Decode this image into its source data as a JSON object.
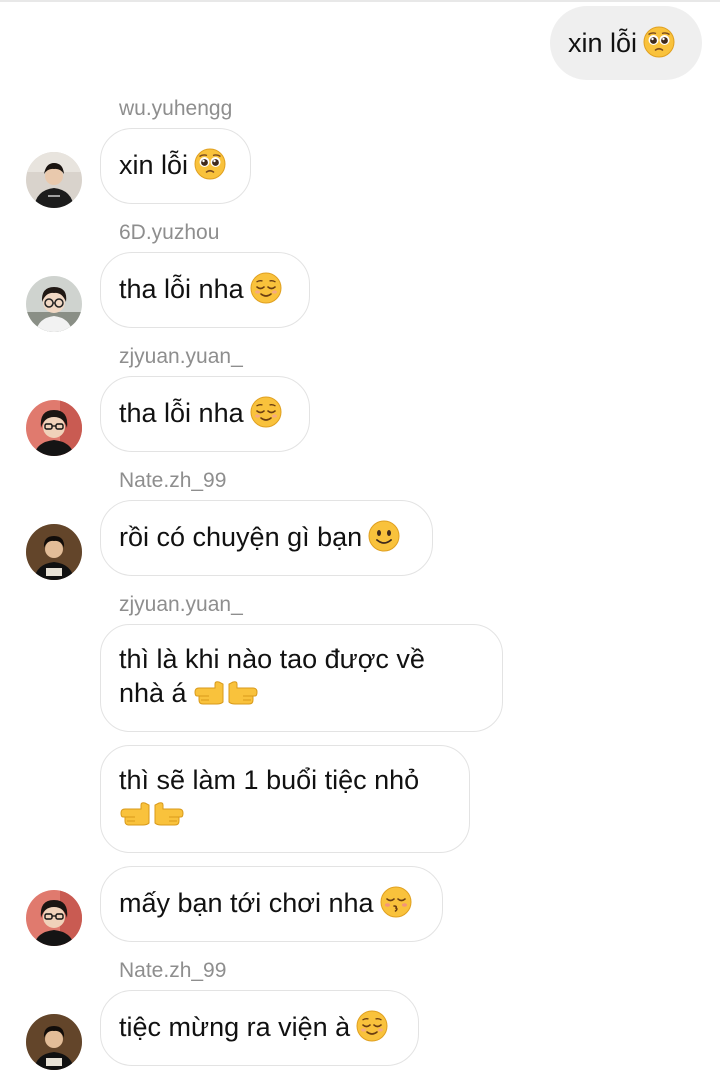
{
  "messages": [
    {
      "type": "outgoing",
      "text": "xin lỗi",
      "emoji": "pleading-face-emoji"
    },
    {
      "type": "incoming",
      "sender": "wu.yuhengg",
      "text": "xin lỗi",
      "emoji": "pleading-face-emoji",
      "avatar": "avatar-wu-yuhengg"
    },
    {
      "type": "incoming",
      "sender": "6D.yuzhou",
      "text": "tha lỗi nha",
      "emoji": "relieved-face-emoji",
      "avatar": "avatar-6d-yuzhou"
    },
    {
      "type": "incoming",
      "sender": "zjyuan.yuan_",
      "text": "tha lỗi nha",
      "emoji": "relieved-face-emoji",
      "avatar": "avatar-zjyuan-yuan"
    },
    {
      "type": "incoming",
      "sender": "Nate.zh_99",
      "text": "rồi có chuyện gì bạn",
      "emoji": "slightly-smiling-face-emoji",
      "avatar": "avatar-nate-zh-99"
    },
    {
      "type": "incoming",
      "sender": "zjyuan.yuan_",
      "line1": "thì là khi nào tao được về",
      "line2": "nhà á",
      "emoji": "pointing-hands-emoji"
    },
    {
      "type": "incoming",
      "line1": "thì sẽ làm 1 buổi tiệc nhỏ",
      "emoji": "pointing-hands-emoji"
    },
    {
      "type": "incoming",
      "text": "mấy bạn tới chơi nha",
      "emoji": "kissing-face-emoji",
      "avatar": "avatar-zjyuan-yuan"
    },
    {
      "type": "incoming",
      "sender": "Nate.zh_99",
      "text": "tiệc mừng ra viện à",
      "emoji": "relieved-face-emoji",
      "avatar": "avatar-nate-zh-99"
    }
  ],
  "colors": {
    "outgoing_bubble": "#efefef",
    "incoming_border": "#e3e3e3",
    "sender_text": "#8e8e8e",
    "message_text": "#111111",
    "emoji_yellow": "#f9c23c"
  }
}
